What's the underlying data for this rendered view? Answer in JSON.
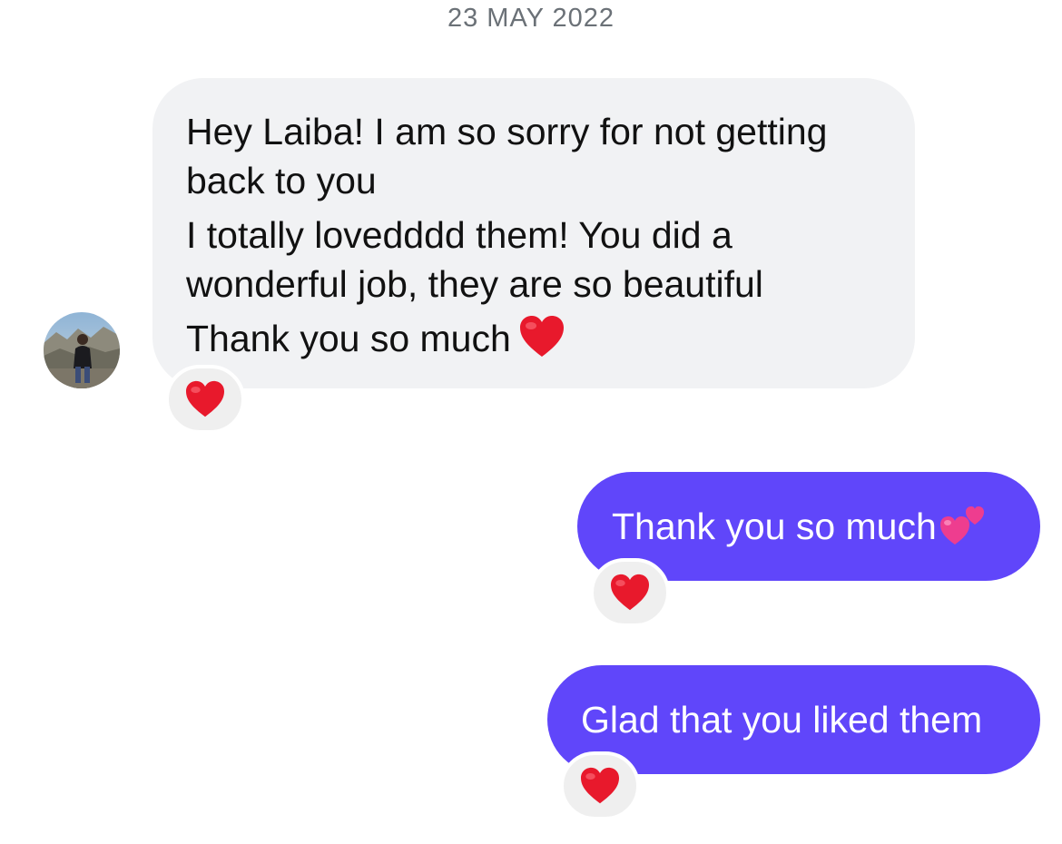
{
  "conversation": {
    "date_separator": "23 MAY 2022",
    "contact_avatar_icon": "contact-avatar-photo",
    "messages": [
      {
        "direction": "incoming",
        "lines": [
          "Hey Laiba! I am so sorry for not getting",
          "back to you",
          "I totally lovedddd them! You did a",
          "wonderful job, they are so beautiful",
          "Thank you so much"
        ],
        "trailing_emoji": "red-heart-icon",
        "reaction": "red-heart-icon"
      },
      {
        "direction": "outgoing",
        "text": "Thank you so much",
        "trailing_emoji": "two-hearts-icon",
        "reaction": "red-heart-icon"
      },
      {
        "direction": "outgoing",
        "text": "Glad that you liked them",
        "reaction": "red-heart-icon"
      }
    ]
  },
  "colors": {
    "incoming_bubble": "#f1f2f4",
    "outgoing_bubble": "#6046fa",
    "reaction_bg": "#efefef",
    "heart": "#e8192c",
    "date_text": "#6b7177"
  }
}
